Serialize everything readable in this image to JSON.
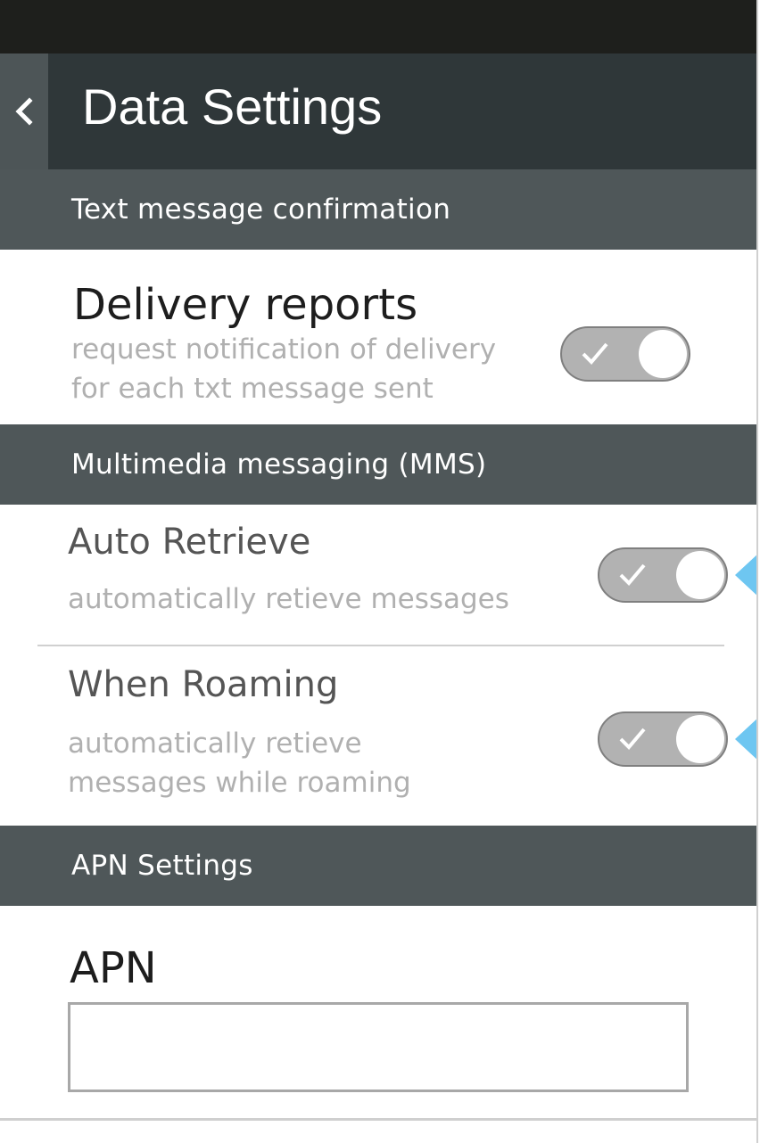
{
  "header": {
    "title": "Data Settings",
    "back_icon": "chevron-left-icon"
  },
  "sections": {
    "text_message": {
      "label": "Text message confirmation",
      "delivery_reports": {
        "title": "Delivery reports",
        "subtitle": "request notification of delivery\nfor each txt message sent",
        "toggle_on": true
      }
    },
    "mms": {
      "label": "Multimedia messaging (MMS)",
      "auto_retrieve": {
        "title": "Auto Retrieve",
        "subtitle": "automatically retieve messages",
        "toggle_on": true
      },
      "when_roaming": {
        "title": "When Roaming",
        "subtitle": "automatically retieve\nmessages while roaming",
        "toggle_on": true
      }
    },
    "apn": {
      "label": "APN Settings",
      "field_label": "APN",
      "field_value": ""
    }
  },
  "colors": {
    "status_bar": "#1e1f1c",
    "header_bg": "#2f3739",
    "section_bg": "#4f5759",
    "toggle_track": "#b2b2b2",
    "pointer_accent": "#6ec6f1"
  }
}
